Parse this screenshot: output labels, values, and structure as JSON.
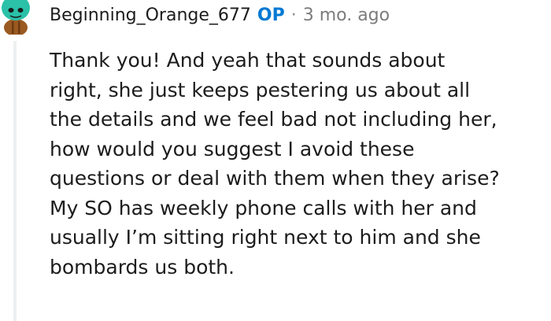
{
  "comment": {
    "author": "Beginning_Orange_677",
    "op_label": "OP",
    "separator": "·",
    "timestamp": "3 mo. ago",
    "avatar_icon": "snoo-avatar-icon",
    "body_lines": [
      "Thank you! And yeah that sounds about",
      "right, she just keeps pestering us about all",
      "the details and we feel bad not including her,",
      "how would you suggest I avoid these",
      "questions or deal with them when they arise?",
      "My SO has weekly phone calls with her and",
      "usually I’m sitting right next to him and she",
      "bombards us both."
    ]
  },
  "colors": {
    "op": "#0079d3",
    "text": "#1c1c1c",
    "meta": "#7c7c7c",
    "thread_line": "#edeff1",
    "avatar_head": "#2ac1a8",
    "avatar_body": "#9a5a22"
  }
}
